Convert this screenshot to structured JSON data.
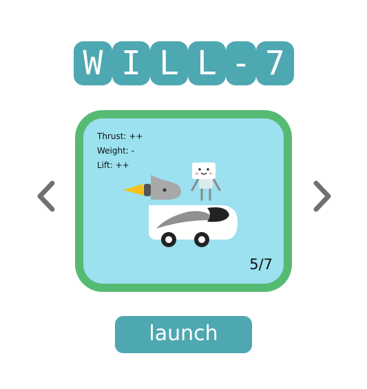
{
  "title": {
    "letters": [
      "W",
      "I",
      "L",
      "L",
      "-",
      "7"
    ]
  },
  "card": {
    "stats": [
      {
        "label": "Thrust:",
        "value": "++"
      },
      {
        "label": "Weight:",
        "value": "-"
      },
      {
        "label": "Lift:",
        "value": "++"
      }
    ],
    "counter": "5/7"
  },
  "nav": {
    "prev_icon": "chevron-left-icon",
    "next_icon": "chevron-right-icon"
  },
  "launch_label": "launch",
  "colors": {
    "title_bg": "#4ea8b1",
    "card_border": "#55bb72",
    "card_bg": "#9be1f0",
    "arrow": "#707070",
    "button_bg": "#4ea8b1"
  }
}
